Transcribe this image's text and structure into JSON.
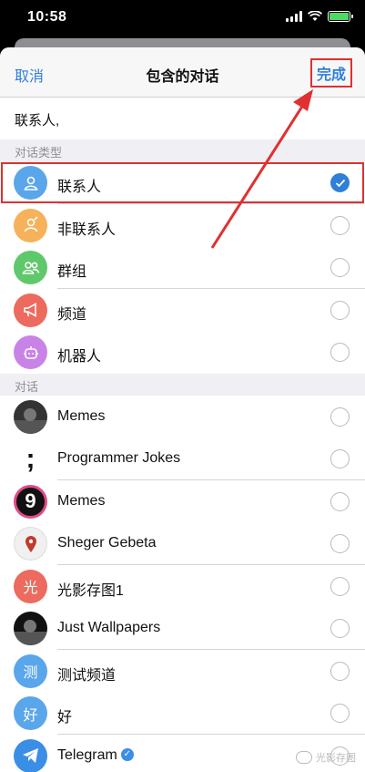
{
  "status": {
    "time": "10:58"
  },
  "nav": {
    "cancel": "取消",
    "title": "包含的对话",
    "done": "完成"
  },
  "selected_text": "联系人,",
  "sections": {
    "types_header": "对话类型",
    "chats_header": "对话"
  },
  "types": [
    {
      "label": "联系人",
      "icon": "person-icon",
      "color": "#5aa6ea",
      "checked": true
    },
    {
      "label": "非联系人",
      "icon": "person-outline-icon",
      "color": "#f6b25a",
      "checked": false
    },
    {
      "label": "群组",
      "icon": "group-icon",
      "color": "#5fc86b",
      "checked": false
    },
    {
      "label": "频道",
      "icon": "megaphone-icon",
      "color": "#ec6a5e",
      "checked": false
    },
    {
      "label": "机器人",
      "icon": "robot-icon",
      "color": "#c983e6",
      "checked": false
    }
  ],
  "chats": [
    {
      "label": "Memes",
      "avatar": "photo",
      "avatar_text": "",
      "color": "#333333"
    },
    {
      "label": "Programmer Jokes",
      "avatar": "semicolon",
      "avatar_text": ";",
      "color": "#ffffff"
    },
    {
      "label": "Memes",
      "avatar": "logo",
      "avatar_text": "9",
      "color": "#111111"
    },
    {
      "label": "Sheger Gebeta",
      "avatar": "map-pin",
      "avatar_text": "",
      "color": "#f0f0f0"
    },
    {
      "label": "光影存图1",
      "avatar": "letter",
      "avatar_text": "光",
      "color": "#ec6a5e"
    },
    {
      "label": "Just Wallpapers",
      "avatar": "photo",
      "avatar_text": "",
      "color": "#111111"
    },
    {
      "label": "测试频道",
      "avatar": "letter",
      "avatar_text": "测",
      "color": "#5aa6ea"
    },
    {
      "label": "好",
      "avatar": "letter",
      "avatar_text": "好",
      "color": "#5aa6ea"
    },
    {
      "label": "Telegram",
      "avatar": "telegram",
      "avatar_text": "",
      "color": "#3a8ee6",
      "verified": true
    }
  ],
  "watermark": "光影存图"
}
